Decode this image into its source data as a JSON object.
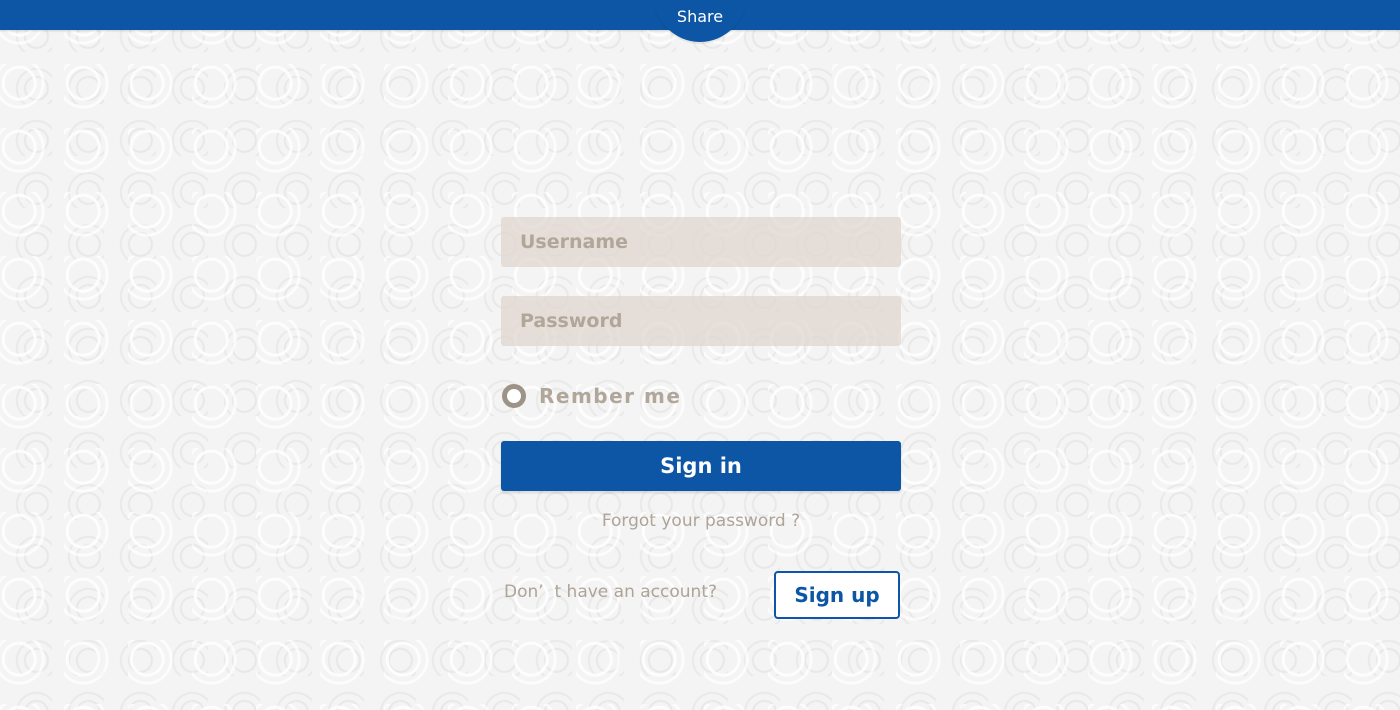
{
  "header": {
    "share_label": "Share"
  },
  "form": {
    "username_placeholder": "Username",
    "username_value": "",
    "password_placeholder": "Password",
    "password_value": "",
    "remember_label": "Rember me",
    "remember_checked": false,
    "signin_label": "Sign in",
    "forgot_label": "Forgot your password ?",
    "no_account_label": "Don’  t have an account?",
    "signup_label": "Sign up"
  },
  "colors": {
    "brand_blue": "#0d56a6",
    "field_background": "#e0d6cd",
    "muted_text": "#aea498",
    "radio_ring": "#9d9487"
  },
  "icons": {
    "remember_radio": "radio-ring-icon"
  }
}
